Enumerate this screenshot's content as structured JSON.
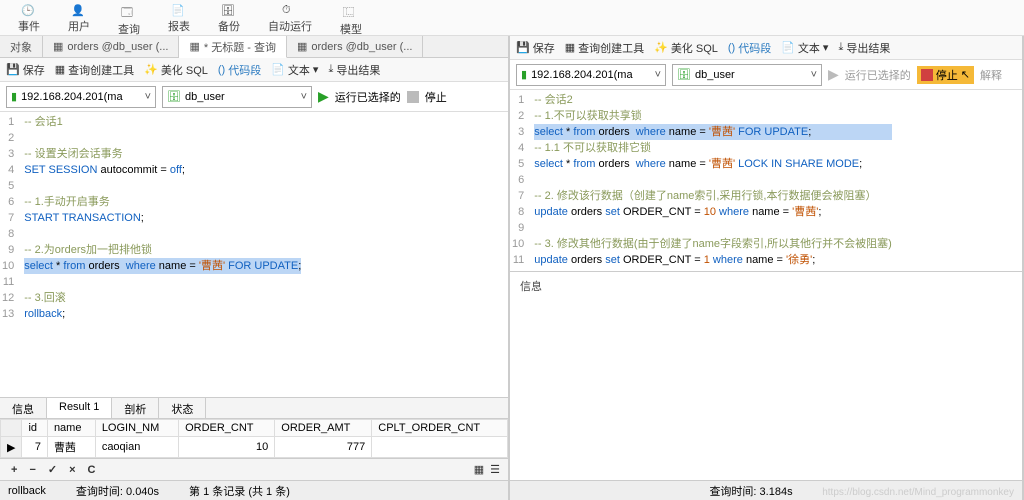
{
  "toolbar": {
    "items": [
      "事件",
      "用户",
      "查询",
      "报表",
      "备份",
      "自动运行",
      "模型"
    ]
  },
  "left": {
    "tabs": [
      "对象",
      "orders @db_user (...",
      "* 无标题 - 查询",
      "orders @db_user (..."
    ],
    "active_tab": 2,
    "subbar": {
      "save": "保存",
      "qb": "查询创建工具",
      "beautify": "美化 SQL",
      "snippets": "代码段",
      "text": "文本",
      "export": "导出结果"
    },
    "conn": {
      "server": "192.168.204.201(ma",
      "db": "db_user",
      "run": "运行已选择的",
      "stop": "停止"
    },
    "code": [
      {
        "n": 1,
        "t": "-- 会话1",
        "cls": "cm-comment"
      },
      {
        "n": 2,
        "t": "",
        "cls": ""
      },
      {
        "n": 3,
        "t": "-- 设置关闭会话事务",
        "cls": "cm-comment"
      },
      {
        "n": 4,
        "html": "<span class='cm-kw'>SET SESSION</span> autocommit = <span class='cm-kw'>off</span>;"
      },
      {
        "n": 5,
        "t": "",
        "cls": ""
      },
      {
        "n": 6,
        "t": "-- 1.手动开启事务",
        "cls": "cm-comment"
      },
      {
        "n": 7,
        "html": "<span class='cm-kw'>START TRANSACTION</span>;"
      },
      {
        "n": 8,
        "t": "",
        "cls": ""
      },
      {
        "n": 9,
        "t": "-- 2.为orders加一把排他锁",
        "cls": "cm-comment"
      },
      {
        "n": 10,
        "hl": true,
        "html": "<span class='cm-kw'>select</span> * <span class='cm-kw'>from</span> orders  <span class='cm-kw'>where</span> name = <span class='cm-str'>'曹茜'</span> <span class='cm-kw'>FOR UPDATE</span>;"
      },
      {
        "n": 11,
        "t": "",
        "cls": ""
      },
      {
        "n": 12,
        "t": "-- 3.回滚",
        "cls": "cm-comment"
      },
      {
        "n": 13,
        "html": "<span class='cm-kw'>rollback</span>;"
      }
    ],
    "result_tabs": [
      "信息",
      "Result 1",
      "剖析",
      "状态"
    ],
    "grid": {
      "cols": [
        "id",
        "name",
        "LOGIN_NM",
        "ORDER_CNT",
        "ORDER_AMT",
        "CPLT_ORDER_CNT"
      ],
      "row": {
        "id": "7",
        "name": "曹茜",
        "login": "caoqian",
        "cnt": "10",
        "amt": "777",
        "cplt": ""
      }
    },
    "footer_ctrls": [
      "+",
      "−",
      "✓",
      "×",
      "C"
    ],
    "status": {
      "left": "rollback",
      "mid": "查询时间: 0.040s",
      "right": "第 1 条记录 (共 1 条)"
    }
  },
  "right": {
    "subbar": {
      "save": "保存",
      "qb": "查询创建工具",
      "beautify": "美化 SQL",
      "snippets": "代码段",
      "text": "文本",
      "export": "导出结果"
    },
    "conn": {
      "server": "192.168.204.201(ma",
      "db": "db_user",
      "run": "运行已选择的",
      "stop": "停止",
      "explain": "解释"
    },
    "code": [
      {
        "n": 1,
        "t": "-- 会话2",
        "cls": "cm-comment"
      },
      {
        "n": 2,
        "t": "-- 1.不可以获取共享锁",
        "cls": "cm-comment"
      },
      {
        "n": 3,
        "hl": true,
        "html": "<span class='cm-kw'>select</span> * <span class='cm-kw'>from</span> orders  <span class='cm-kw'>where</span> name = <span class='cm-str'>'曹茜'</span> <span class='cm-kw'>FOR UPDATE</span>;"
      },
      {
        "n": 4,
        "t": "-- 1.1 不可以获取排它锁",
        "cls": "cm-comment"
      },
      {
        "n": 5,
        "html": "<span class='cm-kw'>select</span> * <span class='cm-kw'>from</span> orders  <span class='cm-kw'>where</span> name = <span class='cm-str'>'曹茜'</span> <span class='cm-kw'>LOCK IN SHARE MODE</span>;"
      },
      {
        "n": 6,
        "t": "",
        "cls": ""
      },
      {
        "n": 7,
        "t": "-- 2. 修改该行数据（创建了name索引,采用行锁,本行数据便会被阻塞）",
        "cls": "cm-comment"
      },
      {
        "n": 8,
        "html": "<span class='cm-kw'>update</span> orders <span class='cm-kw'>set</span> ORDER_CNT = <span class='cm-num'>10</span> <span class='cm-kw'>where</span> name = <span class='cm-str'>'曹茜'</span>;"
      },
      {
        "n": 9,
        "t": "",
        "cls": ""
      },
      {
        "n": 10,
        "t": "-- 3. 修改其他行数据(由于创建了name字段索引,所以其他行并不会被阻塞)",
        "cls": "cm-comment"
      },
      {
        "n": 11,
        "html": "<span class='cm-kw'>update</span> orders <span class='cm-kw'>set</span> ORDER_CNT = <span class='cm-num'>1</span> <span class='cm-kw'>where</span> name = <span class='cm-str'>'徐勇'</span>;"
      }
    ],
    "msg_label": "信息",
    "status": {
      "mid": "查询时间: 3.184s"
    }
  },
  "watermark": "https://blog.csdn.net/Mind_programmonkey"
}
